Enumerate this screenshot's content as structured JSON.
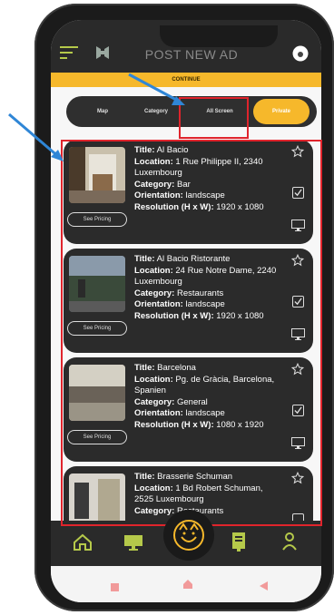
{
  "header": {
    "title": "POST NEW AD"
  },
  "continue_label": "CONTINUE",
  "tabs": [
    {
      "label": "Map"
    },
    {
      "label": "Category"
    },
    {
      "label": "All Screen"
    },
    {
      "label": "Private"
    }
  ],
  "ads": [
    {
      "title_label": "Title:",
      "title": "Al Bacio",
      "location_label": "Location:",
      "location": "1 Rue Philippe II, 2340 Luxembourg",
      "category_label": "Category:",
      "category": "Bar",
      "orientation_label": "Orientation:",
      "orientation": "landscape",
      "resolution_label": "Resolution (H x W):",
      "resolution": "1920 x 1080",
      "pricing_label": "See Pricing",
      "checked": true
    },
    {
      "title_label": "Title:",
      "title": "Al Bacio Ristorante",
      "location_label": "Location:",
      "location": "24 Rue Notre Dame, 2240 Luxembourg",
      "category_label": "Category:",
      "category": "Restaurants",
      "orientation_label": "Orientation:",
      "orientation": "landscape",
      "resolution_label": "Resolution (H x W):",
      "resolution": "1920 x 1080",
      "pricing_label": "See Pricing",
      "checked": true
    },
    {
      "title_label": "Title:",
      "title": "Barcelona",
      "location_label": "Location:",
      "location": "Pg. de Gràcia, Barcelona, Spanien",
      "category_label": "Category:",
      "category": "General",
      "orientation_label": "Orientation:",
      "orientation": "landscape",
      "resolution_label": "Resolution (H x W):",
      "resolution": "1080 x 1920",
      "pricing_label": "See Pricing",
      "checked": true
    },
    {
      "title_label": "Title:",
      "title": "Brasserie Schuman",
      "location_label": "Location:",
      "location": "1 Bd Robert Schuman, 2525 Luxembourg",
      "category_label": "Category:",
      "category": "Restaurants",
      "checked": false
    }
  ],
  "colors": {
    "accent": "#f6b82b",
    "card": "#2b2b2b",
    "highlight": "#e0242c",
    "nav_icon": "#b5c94a"
  }
}
